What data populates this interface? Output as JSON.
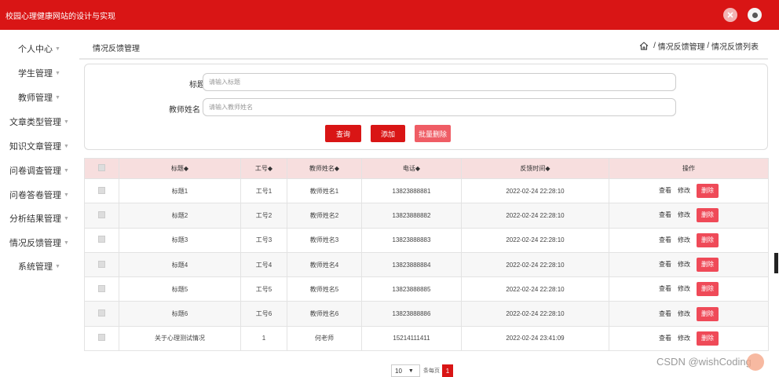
{
  "header": {
    "title": "校园心理健康网站的设计与实现"
  },
  "sidebar": {
    "items": [
      {
        "label": "个人中心"
      },
      {
        "label": "学生管理"
      },
      {
        "label": "教师管理"
      },
      {
        "label": "文章类型管理"
      },
      {
        "label": "知识文章管理"
      },
      {
        "label": "问卷调查管理"
      },
      {
        "label": "问卷答卷管理"
      },
      {
        "label": "分析结果管理"
      },
      {
        "label": "情况反馈管理"
      },
      {
        "label": "系统管理"
      }
    ]
  },
  "page": {
    "title": "情况反馈管理",
    "breadcrumb": [
      "情况反馈管理",
      "情况反馈列表"
    ]
  },
  "search": {
    "title_label": "标题",
    "title_placeholder": "请输入标题",
    "teacher_label": "教师姓名",
    "teacher_placeholder": "请输入教师姓名",
    "query_btn": "查询",
    "add_btn": "添加",
    "batch_delete_btn": "批量删除"
  },
  "table": {
    "headers": [
      "标题◆",
      "工号◆",
      "教师姓名◆",
      "电话◆",
      "反馈时间◆",
      "操作"
    ],
    "rows": [
      [
        "标题1",
        "工号1",
        "教师姓名1",
        "13823888881",
        "2022-02-24 22:28:10"
      ],
      [
        "标题2",
        "工号2",
        "教师姓名2",
        "13823888882",
        "2022-02-24 22:28:10"
      ],
      [
        "标题3",
        "工号3",
        "教师姓名3",
        "13823888883",
        "2022-02-24 22:28:10"
      ],
      [
        "标题4",
        "工号4",
        "教师姓名4",
        "13823888884",
        "2022-02-24 22:28:10"
      ],
      [
        "标题5",
        "工号5",
        "教师姓名5",
        "13823888885",
        "2022-02-24 22:28:10"
      ],
      [
        "标题6",
        "工号6",
        "教师姓名6",
        "13823888886",
        "2022-02-24 22:28:10"
      ],
      [
        "关于心理测试情况",
        "1",
        "何老师",
        "15214111411",
        "2022-02-24 23:41:09"
      ]
    ],
    "actions": {
      "view": "查看",
      "edit": "修改",
      "delete": "删除"
    }
  },
  "pager": {
    "page_size": "10",
    "label": "条每页",
    "current_page": "1"
  },
  "watermark": "CSDN @wishCoding",
  "colors": {
    "primary": "#d91515",
    "danger": "#ef4a58",
    "header_row": "#f7dede"
  }
}
